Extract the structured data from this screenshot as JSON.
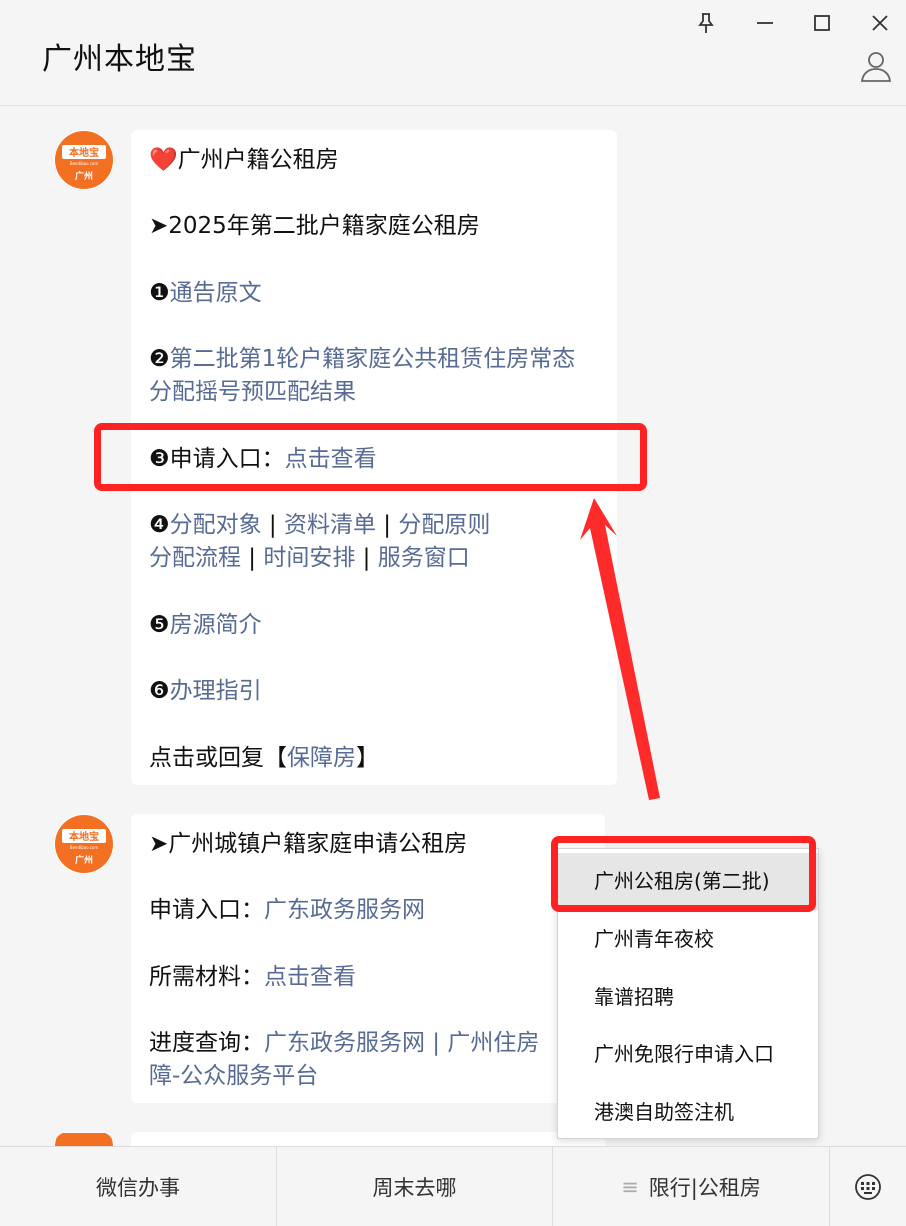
{
  "app": {
    "title": "广州本地宝"
  },
  "window": {
    "pin_icon": "pin-icon",
    "minimize_icon": "minimize-icon",
    "maximize_icon": "maximize-icon",
    "close_icon": "close-icon",
    "profile_icon": "person-icon"
  },
  "avatar": {
    "top_text": "本地宝",
    "sub_text": "Bendibao.com",
    "city_text": "广州",
    "color": "#f36f21"
  },
  "message1": {
    "heart": "❤️",
    "title": "广州户籍公租房",
    "section": "➤2025年第二批户籍家庭公租房",
    "item1_num": "❶",
    "item1_link": "通告原文",
    "item2_num": "❷",
    "item2_link_line1": "第二批第1轮户籍家庭公共租赁住房常态",
    "item2_link_line2": "分配摇号预匹配结果",
    "item3_num": "❸",
    "item3_label": "申请入口：",
    "item3_link": "点击查看",
    "item4_num": "❹",
    "item4_links": [
      "分配对象",
      "资料清单",
      "分配原则",
      "分配流程",
      "时间安排",
      "服务窗口"
    ],
    "separator": " | ",
    "item5_num": "❺",
    "item5_link": "房源简介",
    "item6_num": "❻",
    "item6_link": "办理指引",
    "footer_prefix": "点击或回复【",
    "footer_link": "保障房",
    "footer_suffix": "】"
  },
  "message2": {
    "title": "➤广州城镇户籍家庭申请公租房",
    "apply_label": "申请入口：",
    "apply_link": "广东政务服务网",
    "material_label": "所需材料：",
    "material_link": "点击查看",
    "progress_label": "进度查询：",
    "progress_link1": "广东政务服务网",
    "progress_sep": " | ",
    "progress_link2_line1": "广州住房",
    "progress_link2_line2": "障-公众服务平台"
  },
  "popup_menu": {
    "items": [
      "广州公租房(第二批)",
      "广州青年夜校",
      "靠谱招聘",
      "广州免限行申请入口",
      "港澳自助签注机"
    ]
  },
  "bottom_bar": {
    "items": [
      "微信办事",
      "周末去哪",
      "限行|公租房"
    ],
    "menu_glyph": "≡",
    "keyboard_icon": "keyboard-icon"
  },
  "colors": {
    "link": "#576b95",
    "highlight": "#ff2222",
    "accent_orange": "#f36f21"
  }
}
